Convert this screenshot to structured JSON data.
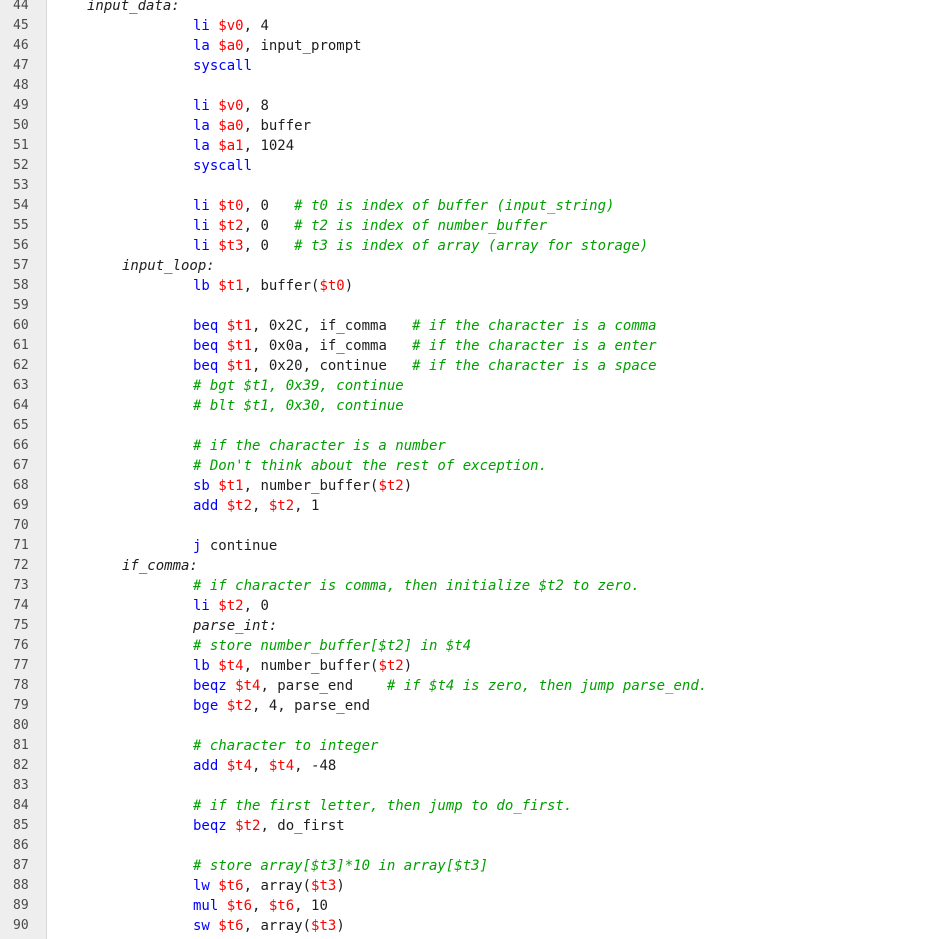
{
  "colors": {
    "instruction": "#0000ff",
    "register": "#ff0000",
    "comment": "#00a000",
    "text": "#1e1e1e",
    "gutter_bg": "#eeeeee",
    "line_number": "#4a4a4a"
  },
  "lines": [
    {
      "n": "44",
      "indent": 40,
      "tokens": [
        {
          "t": "lbl",
          "v": "input_data:"
        }
      ]
    },
    {
      "n": "45",
      "indent": 146,
      "tokens": [
        {
          "t": "kw",
          "v": "li "
        },
        {
          "t": "reg",
          "v": "$v0"
        },
        {
          "t": "txt",
          "v": ", 4"
        }
      ]
    },
    {
      "n": "46",
      "indent": 146,
      "tokens": [
        {
          "t": "kw",
          "v": "la "
        },
        {
          "t": "reg",
          "v": "$a0"
        },
        {
          "t": "txt",
          "v": ", input_prompt"
        }
      ]
    },
    {
      "n": "47",
      "indent": 146,
      "tokens": [
        {
          "t": "kw",
          "v": "syscall"
        }
      ]
    },
    {
      "n": "48",
      "indent": 146,
      "tokens": []
    },
    {
      "n": "49",
      "indent": 146,
      "tokens": [
        {
          "t": "kw",
          "v": "li "
        },
        {
          "t": "reg",
          "v": "$v0"
        },
        {
          "t": "txt",
          "v": ", 8"
        }
      ]
    },
    {
      "n": "50",
      "indent": 146,
      "tokens": [
        {
          "t": "kw",
          "v": "la "
        },
        {
          "t": "reg",
          "v": "$a0"
        },
        {
          "t": "txt",
          "v": ", buffer"
        }
      ]
    },
    {
      "n": "51",
      "indent": 146,
      "tokens": [
        {
          "t": "kw",
          "v": "la "
        },
        {
          "t": "reg",
          "v": "$a1"
        },
        {
          "t": "txt",
          "v": ", 1024"
        }
      ]
    },
    {
      "n": "52",
      "indent": 146,
      "tokens": [
        {
          "t": "kw",
          "v": "syscall"
        }
      ]
    },
    {
      "n": "53",
      "indent": 146,
      "tokens": []
    },
    {
      "n": "54",
      "indent": 146,
      "tokens": [
        {
          "t": "kw",
          "v": "li "
        },
        {
          "t": "reg",
          "v": "$t0"
        },
        {
          "t": "txt",
          "v": ", 0   "
        },
        {
          "t": "cm",
          "v": "# t0 is index of buffer (input_string)"
        }
      ]
    },
    {
      "n": "55",
      "indent": 146,
      "tokens": [
        {
          "t": "kw",
          "v": "li "
        },
        {
          "t": "reg",
          "v": "$t2"
        },
        {
          "t": "txt",
          "v": ", 0   "
        },
        {
          "t": "cm",
          "v": "# t2 is index of number_buffer"
        }
      ]
    },
    {
      "n": "56",
      "indent": 146,
      "tokens": [
        {
          "t": "kw",
          "v": "li "
        },
        {
          "t": "reg",
          "v": "$t3"
        },
        {
          "t": "txt",
          "v": ", 0   "
        },
        {
          "t": "cm",
          "v": "# t3 is index of array (array for storage)"
        }
      ]
    },
    {
      "n": "57",
      "indent": 75,
      "tokens": [
        {
          "t": "lbl",
          "v": "input_loop:"
        }
      ]
    },
    {
      "n": "58",
      "indent": 146,
      "tokens": [
        {
          "t": "kw",
          "v": "lb "
        },
        {
          "t": "reg",
          "v": "$t1"
        },
        {
          "t": "txt",
          "v": ", buffer("
        },
        {
          "t": "reg",
          "v": "$t0"
        },
        {
          "t": "txt",
          "v": ")"
        }
      ]
    },
    {
      "n": "59",
      "indent": 146,
      "tokens": []
    },
    {
      "n": "60",
      "indent": 146,
      "tokens": [
        {
          "t": "kw",
          "v": "beq "
        },
        {
          "t": "reg",
          "v": "$t1"
        },
        {
          "t": "txt",
          "v": ", 0x2C, if_comma   "
        },
        {
          "t": "cm",
          "v": "# if the character is a comma"
        }
      ]
    },
    {
      "n": "61",
      "indent": 146,
      "tokens": [
        {
          "t": "kw",
          "v": "beq "
        },
        {
          "t": "reg",
          "v": "$t1"
        },
        {
          "t": "txt",
          "v": ", 0x0a, if_comma   "
        },
        {
          "t": "cm",
          "v": "# if the character is a enter"
        }
      ]
    },
    {
      "n": "62",
      "indent": 146,
      "tokens": [
        {
          "t": "kw",
          "v": "beq "
        },
        {
          "t": "reg",
          "v": "$t1"
        },
        {
          "t": "txt",
          "v": ", 0x20, continue   "
        },
        {
          "t": "cm",
          "v": "# if the character is a space"
        }
      ]
    },
    {
      "n": "63",
      "indent": 146,
      "tokens": [
        {
          "t": "cm",
          "v": "# bgt $t1, 0x39, continue"
        }
      ]
    },
    {
      "n": "64",
      "indent": 146,
      "tokens": [
        {
          "t": "cm",
          "v": "# blt $t1, 0x30, continue"
        }
      ]
    },
    {
      "n": "65",
      "indent": 146,
      "tokens": []
    },
    {
      "n": "66",
      "indent": 146,
      "tokens": [
        {
          "t": "cm",
          "v": "# if the character is a number"
        }
      ]
    },
    {
      "n": "67",
      "indent": 146,
      "tokens": [
        {
          "t": "cm",
          "v": "# Don't think about the rest of exception."
        }
      ]
    },
    {
      "n": "68",
      "indent": 146,
      "tokens": [
        {
          "t": "kw",
          "v": "sb "
        },
        {
          "t": "reg",
          "v": "$t1"
        },
        {
          "t": "txt",
          "v": ", number_buffer("
        },
        {
          "t": "reg",
          "v": "$t2"
        },
        {
          "t": "txt",
          "v": ")"
        }
      ]
    },
    {
      "n": "69",
      "indent": 146,
      "tokens": [
        {
          "t": "kw",
          "v": "add "
        },
        {
          "t": "reg",
          "v": "$t2"
        },
        {
          "t": "txt",
          "v": ", "
        },
        {
          "t": "reg",
          "v": "$t2"
        },
        {
          "t": "txt",
          "v": ", 1"
        }
      ]
    },
    {
      "n": "70",
      "indent": 146,
      "tokens": []
    },
    {
      "n": "71",
      "indent": 146,
      "tokens": [
        {
          "t": "kw",
          "v": "j "
        },
        {
          "t": "txt",
          "v": "continue"
        }
      ]
    },
    {
      "n": "72",
      "indent": 75,
      "tokens": [
        {
          "t": "lbl",
          "v": "if_comma:"
        }
      ]
    },
    {
      "n": "73",
      "indent": 146,
      "tokens": [
        {
          "t": "cm",
          "v": "# if character is comma, then initialize $t2 to zero."
        }
      ]
    },
    {
      "n": "74",
      "indent": 146,
      "tokens": [
        {
          "t": "kw",
          "v": "li "
        },
        {
          "t": "reg",
          "v": "$t2"
        },
        {
          "t": "txt",
          "v": ", 0"
        }
      ]
    },
    {
      "n": "75",
      "indent": 146,
      "tokens": [
        {
          "t": "lbl",
          "v": "parse_int:"
        }
      ]
    },
    {
      "n": "76",
      "indent": 146,
      "tokens": [
        {
          "t": "cm",
          "v": "# store number_buffer[$t2] in $t4"
        }
      ]
    },
    {
      "n": "77",
      "indent": 146,
      "tokens": [
        {
          "t": "kw",
          "v": "lb "
        },
        {
          "t": "reg",
          "v": "$t4"
        },
        {
          "t": "txt",
          "v": ", number_buffer("
        },
        {
          "t": "reg",
          "v": "$t2"
        },
        {
          "t": "txt",
          "v": ")"
        }
      ]
    },
    {
      "n": "78",
      "indent": 146,
      "tokens": [
        {
          "t": "kw",
          "v": "beqz "
        },
        {
          "t": "reg",
          "v": "$t4"
        },
        {
          "t": "txt",
          "v": ", parse_end    "
        },
        {
          "t": "cm",
          "v": "# if $t4 is zero, then jump parse_end."
        }
      ]
    },
    {
      "n": "79",
      "indent": 146,
      "tokens": [
        {
          "t": "kw",
          "v": "bge "
        },
        {
          "t": "reg",
          "v": "$t2"
        },
        {
          "t": "txt",
          "v": ", 4, parse_end"
        }
      ]
    },
    {
      "n": "80",
      "indent": 146,
      "tokens": []
    },
    {
      "n": "81",
      "indent": 146,
      "tokens": [
        {
          "t": "cm",
          "v": "# character to integer"
        }
      ]
    },
    {
      "n": "82",
      "indent": 146,
      "tokens": [
        {
          "t": "kw",
          "v": "add "
        },
        {
          "t": "reg",
          "v": "$t4"
        },
        {
          "t": "txt",
          "v": ", "
        },
        {
          "t": "reg",
          "v": "$t4"
        },
        {
          "t": "txt",
          "v": ", -48"
        }
      ]
    },
    {
      "n": "83",
      "indent": 146,
      "tokens": []
    },
    {
      "n": "84",
      "indent": 146,
      "tokens": [
        {
          "t": "cm",
          "v": "# if the first letter, then jump to do_first."
        }
      ]
    },
    {
      "n": "85",
      "indent": 146,
      "tokens": [
        {
          "t": "kw",
          "v": "beqz "
        },
        {
          "t": "reg",
          "v": "$t2"
        },
        {
          "t": "txt",
          "v": ", do_first"
        }
      ]
    },
    {
      "n": "86",
      "indent": 146,
      "tokens": []
    },
    {
      "n": "87",
      "indent": 146,
      "tokens": [
        {
          "t": "cm",
          "v": "# store array[$t3]*10 in array[$t3]"
        }
      ]
    },
    {
      "n": "88",
      "indent": 146,
      "tokens": [
        {
          "t": "kw",
          "v": "lw "
        },
        {
          "t": "reg",
          "v": "$t6"
        },
        {
          "t": "txt",
          "v": ", array("
        },
        {
          "t": "reg",
          "v": "$t3"
        },
        {
          "t": "txt",
          "v": ")"
        }
      ]
    },
    {
      "n": "89",
      "indent": 146,
      "tokens": [
        {
          "t": "kw",
          "v": "mul "
        },
        {
          "t": "reg",
          "v": "$t6"
        },
        {
          "t": "txt",
          "v": ", "
        },
        {
          "t": "reg",
          "v": "$t6"
        },
        {
          "t": "txt",
          "v": ", 10"
        }
      ]
    },
    {
      "n": "90",
      "indent": 146,
      "tokens": [
        {
          "t": "kw",
          "v": "sw "
        },
        {
          "t": "reg",
          "v": "$t6"
        },
        {
          "t": "txt",
          "v": ", array("
        },
        {
          "t": "reg",
          "v": "$t3"
        },
        {
          "t": "txt",
          "v": ")"
        }
      ]
    }
  ]
}
